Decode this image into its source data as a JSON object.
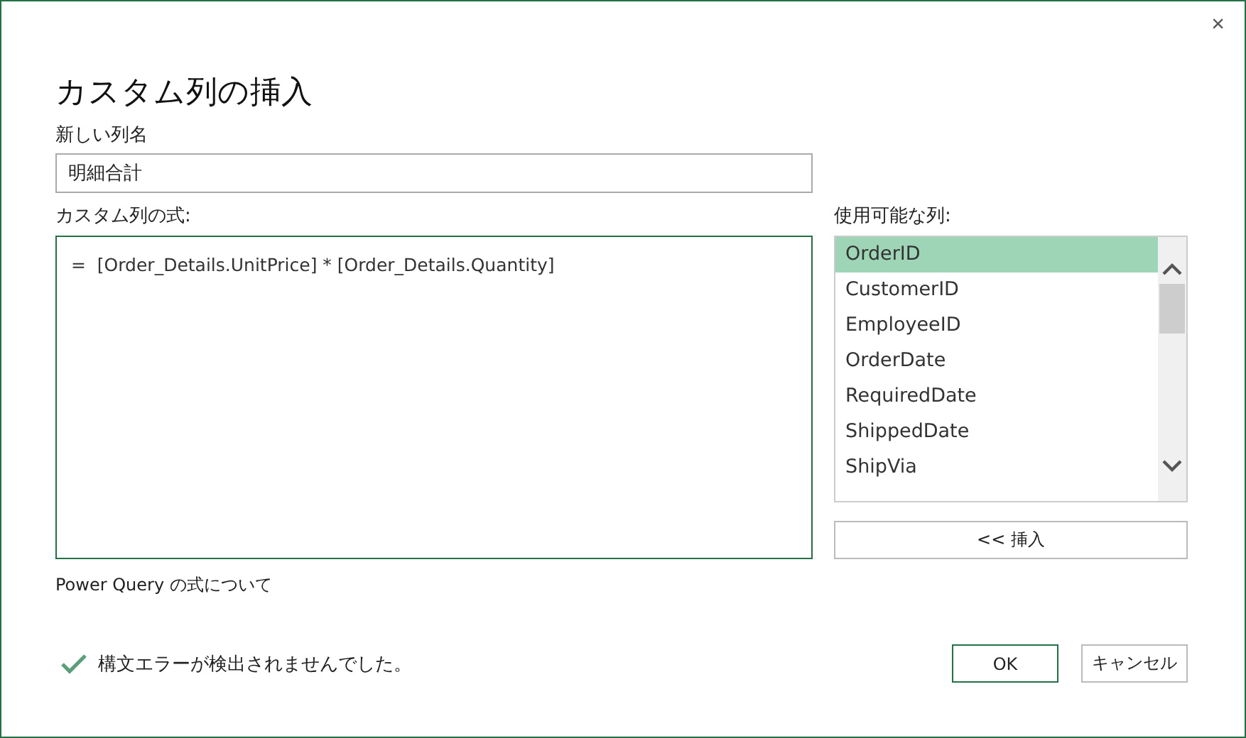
{
  "window": {
    "close": "×",
    "title": "カスタム列の挿入"
  },
  "new_column_name": {
    "label": "新しい列名",
    "value": "明細合計"
  },
  "formula": {
    "label": "カスタム列の式:",
    "value": "=  [Order_Details.UnitPrice] * [Order_Details.Quantity]"
  },
  "available_columns": {
    "label": "使用可能な列:",
    "items": [
      {
        "label": "OrderID",
        "selected": true
      },
      {
        "label": "CustomerID",
        "selected": false
      },
      {
        "label": "EmployeeID",
        "selected": false
      },
      {
        "label": "OrderDate",
        "selected": false
      },
      {
        "label": "RequiredDate",
        "selected": false
      },
      {
        "label": "ShippedDate",
        "selected": false
      },
      {
        "label": "ShipVia",
        "selected": false
      }
    ],
    "insert_button": "<< 挿入"
  },
  "help_link": "Power Query の式について",
  "status": {
    "ok": true,
    "message": "構文エラーが検出されませんでした。"
  },
  "buttons": [
    {
      "label": "OK",
      "default": true
    },
    {
      "label": "キャンセル",
      "default": false
    }
  ]
}
